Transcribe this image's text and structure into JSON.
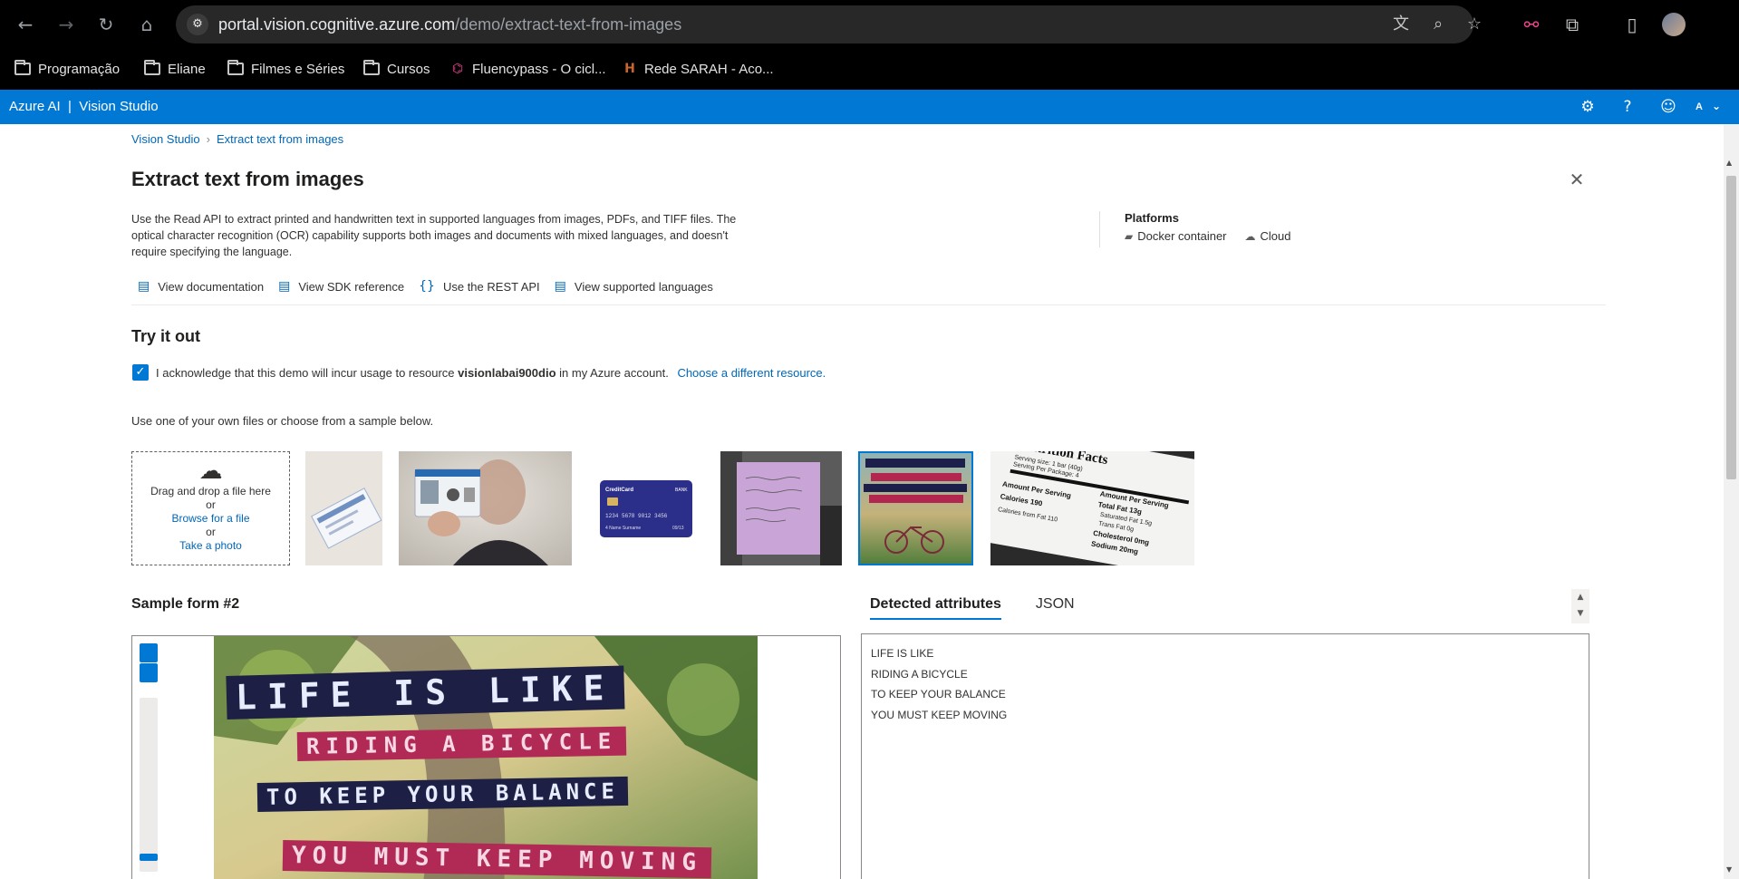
{
  "browser": {
    "url_host": "portal.vision.cognitive.azure.com",
    "url_path": "/demo/extract-text-from-images",
    "bookmarks": [
      {
        "label": "Programação",
        "icon": "folder-icon"
      },
      {
        "label": "Eliane",
        "icon": "folder-icon"
      },
      {
        "label": "Filmes e Séries",
        "icon": "folder-icon"
      },
      {
        "label": "Cursos",
        "icon": "folder-icon"
      },
      {
        "label": "Fluencypass - O cicl...",
        "icon": "fluencypass-icon"
      },
      {
        "label": "Rede SARAH - Aco...",
        "icon": "sarah-icon"
      }
    ]
  },
  "header": {
    "brand": "Azure AI  |  Vision Studio",
    "user_initial": "A"
  },
  "breadcrumb": {
    "root": "Vision Studio",
    "current": "Extract text from images"
  },
  "page": {
    "title": "Extract text from images",
    "description": "Use the Read API to extract printed and handwritten text in supported languages from images, PDFs, and TIFF files. The optical character recognition (OCR) capability supports both images and documents with mixed languages, and doesn't require specifying the language.",
    "platforms_title": "Platforms",
    "platform_docker": "Docker container",
    "platform_cloud": "Cloud",
    "links": {
      "documentation": "View documentation",
      "sdk": "View SDK reference",
      "rest": "Use the REST API",
      "languages": "View supported languages"
    }
  },
  "try_it": {
    "title": "Try it out",
    "ack_prefix": "I acknowledge that this demo will incur usage to resource",
    "resource": "visionlabai900dio",
    "ack_suffix": "in my Azure account.",
    "choose_link": "Choose a different resource.",
    "use_own": "Use one of your own files or choose from a sample below.",
    "upload": {
      "drag": "Drag and drop a file here",
      "or1": "or",
      "browse": "Browse for a file",
      "or2": "or",
      "photo": "Take a photo"
    },
    "card_thumb": {
      "brand": "CreditCard",
      "bank": "BANK",
      "number": "1234 5678 9012 3456",
      "name": "4 Name Surname",
      "exp": "09/13"
    },
    "nutrition_thumb": {
      "title": "Nutrition Facts",
      "serving_size": "Serving size: 1 bar (40g)",
      "per_package": "Serving Per Package: 4",
      "amount": "Amount Per Serving",
      "calories": "Calories 190",
      "fat_cal": "Calories from Fat 110",
      "total_fat": "Total Fat 13g",
      "sat_fat": "Saturated Fat 1.5g",
      "trans_fat": "Trans Fat 0g",
      "cholesterol": "Cholesterol 0mg",
      "sodium": "Sodium 20mg"
    }
  },
  "sample": {
    "title": "Sample form #2",
    "poster_lines": [
      "LIFE IS LIKE",
      "RIDING A BICYCLE",
      "TO KEEP YOUR BALANCE",
      "YOU MUST KEEP MOVING"
    ]
  },
  "results": {
    "tab_detected": "Detected attributes",
    "tab_json": "JSON",
    "lines": [
      "LIFE IS LIKE",
      "RIDING A BICYCLE",
      "TO KEEP YOUR BALANCE",
      "YOU MUST KEEP MOVING"
    ]
  },
  "colors": {
    "azure_blue": "#0078d4",
    "link_blue": "#0067b8",
    "browser_bg": "#000000"
  }
}
